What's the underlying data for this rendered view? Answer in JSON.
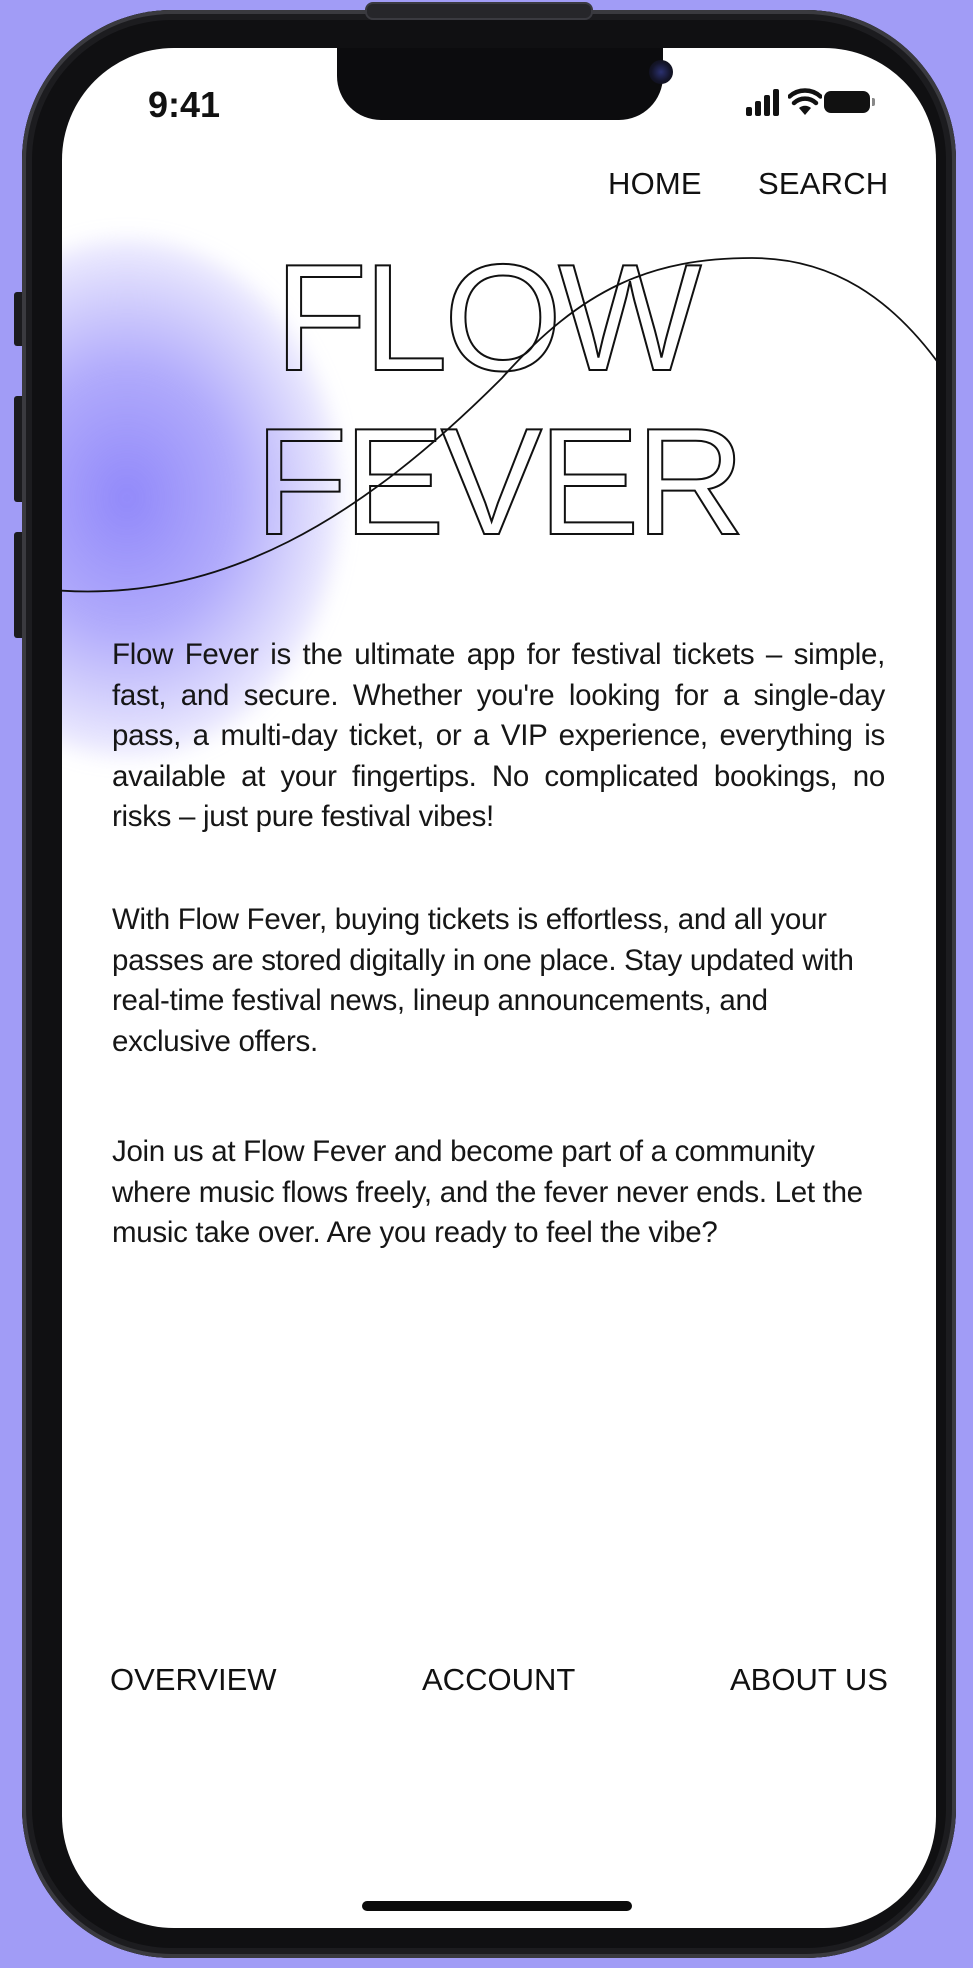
{
  "status_bar": {
    "time": "9:41",
    "signal_icon": "cellular-signal-icon",
    "wifi_icon": "wifi-icon",
    "battery_icon": "battery-icon"
  },
  "top_nav": {
    "home": "HOME",
    "search": "SEARCH"
  },
  "hero": {
    "line1": "FLOW",
    "line2": "FEVER"
  },
  "content": {
    "paragraph1": "Flow Fever is the ultimate app for festival tickets – simple, fast, and secure. Whether you're looking for a single-day pass, a multi-day ticket, or a VIP experience, everything is available at your fingertips. No complicated bookings, no risks – just pure festival vibes!",
    "paragraph2": "With Flow Fever, buying tickets is effortless, and all your passes are stored digitally in one place. Stay updated with real-time festival news, lineup announcements, and exclusive offers.",
    "paragraph3": "Join us at Flow Fever and become part of a community where music flows freely, and the fever never ends. Let the music take over. Are you ready to feel the vibe?"
  },
  "bottom_nav": {
    "overview": "OVERVIEW",
    "account": "ACCOUNT",
    "about": "ABOUT US"
  },
  "colors": {
    "background": "#a19cf6",
    "accent_blob": "#8b82fa",
    "text": "#111111"
  }
}
